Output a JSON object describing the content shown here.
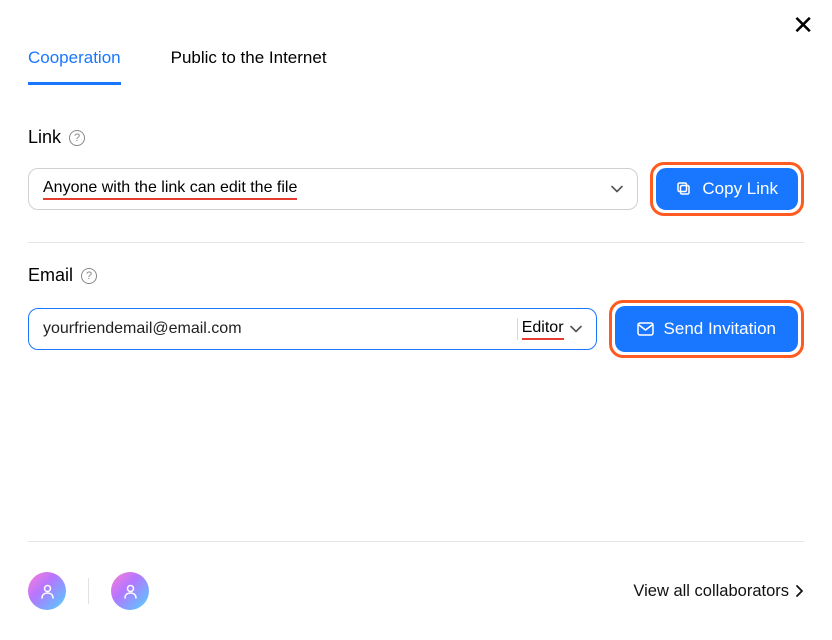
{
  "tabs": {
    "cooperation": "Cooperation",
    "public": "Public to the Internet"
  },
  "link_section": {
    "label": "Link",
    "permission_text": "Anyone with the link can edit the file",
    "copy_button": "Copy Link"
  },
  "email_section": {
    "label": "Email",
    "value": "yourfriendemail@email.com",
    "role": "Editor",
    "send_button": "Send Invitation"
  },
  "footer": {
    "view_all": "View all collaborators"
  }
}
